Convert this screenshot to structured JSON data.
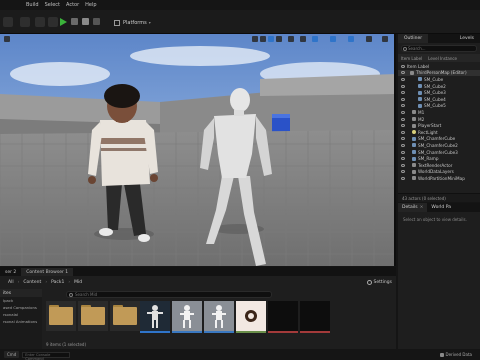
{
  "menu": {
    "items": [
      "Build",
      "Select",
      "Actor",
      "Help"
    ]
  },
  "toolbar": {
    "platforms_label": "Platforms"
  },
  "outliner": {
    "tab_label": "Outliner",
    "tab2_label": "Levels",
    "search_placeholder": "Search...",
    "col_item": "Item Label",
    "col_type": "Level Instance",
    "rows": [
      "Item Label",
      "ThirdPersonMap (Editor)",
      "SM_Cube",
      "SM_Cube2",
      "SM_Cube3",
      "SM_Cube4",
      "SM_Cube5",
      "M1",
      "M2",
      "PlayerStart",
      "RectLight",
      "SM_ChamferCube",
      "SM_ChamferCube2",
      "SM_ChamferCube3",
      "SM_Ramp",
      "TextRenderActor",
      "WorldDataLayers",
      "WorldPartitionMiniMap"
    ],
    "footer": "43 actors (0 selected)"
  },
  "details": {
    "tab_label": "Details",
    "tab2_label": "World Pa",
    "empty_text": "Select an object to view details."
  },
  "content_browser": {
    "tabs": [
      "ser 2",
      "Content Browser 1"
    ],
    "path": [
      "All",
      "Content",
      "Pack1",
      "Mid"
    ],
    "settings_label": "Settings",
    "search_placeholder": "Search Mid",
    "sidebar_header": "ites",
    "sidebar_items": [
      "Ipack",
      "ased Companions",
      "rsonalal",
      "rsonal Animations"
    ],
    "status": "9 items (1 selected)"
  },
  "statusbar": {
    "cmd_label": "Cmd",
    "cmd_placeholder": "Enter Console Command",
    "derived_label": "Derived Data"
  },
  "colors": {
    "accent": "#2f74c9",
    "play": "#3bb33b",
    "folder": "#c19a57"
  }
}
